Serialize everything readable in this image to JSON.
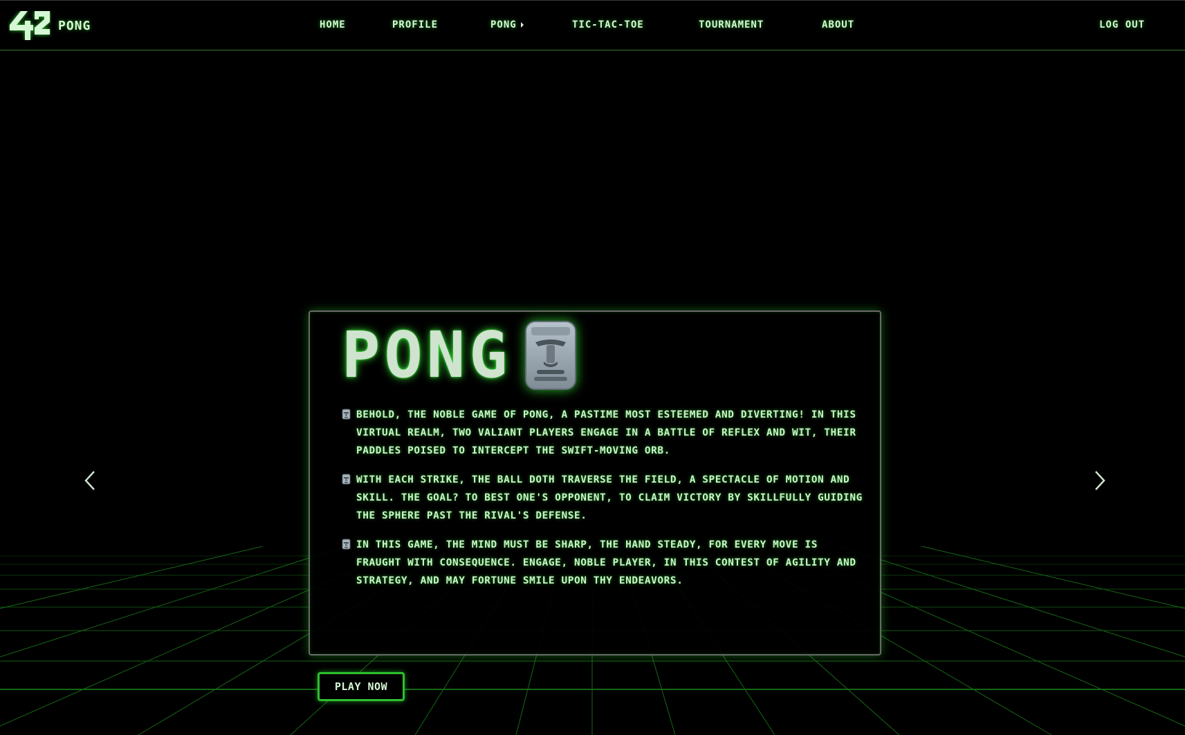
{
  "navbar": {
    "brand_text": "PONG",
    "links": {
      "home": "HOME",
      "profile": "PROFILE",
      "pong": "PONG",
      "tictactoe": "TIC-TAC-TOE",
      "tournament": "TOURNAMENT",
      "about": "ABOUT",
      "logout": "LOG OUT"
    }
  },
  "card": {
    "title": "PONG",
    "paragraphs": [
      "BEHOLD, THE NOBLE GAME OF PONG, A PASTIME MOST ESTEEMED AND DIVERTING! IN THIS VIRTUAL REALM, TWO VALIANT PLAYERS ENGAGE IN A BATTLE OF REFLEX AND WIT, THEIR PADDLES POISED TO INTERCEPT THE SWIFT-MOVING ORB.",
      "WITH EACH STRIKE, THE BALL DOTH TRAVERSE THE FIELD, A SPECTACLE OF MOTION AND SKILL. THE GOAL? TO BEST ONE'S OPPONENT, TO CLAIM VICTORY BY SKILLFULLY GUIDING THE SPHERE PAST THE RIVAL'S DEFENSE.",
      "IN THIS GAME, THE MIND MUST BE SHARP, THE HAND STEADY, FOR EVERY MOVE IS FRAUGHT WITH CONSEQUENCE. ENGAGE, NOBLE PLAYER, IN THIS CONTEST OF AGILITY AND STRATEGY, AND MAY FORTUNE SMILE UPON THY ENDEAVORS."
    ]
  },
  "play_button": "PLAY NOW",
  "icons": {
    "logo": "42-logo",
    "title_icon": "moai-icon",
    "paragraph_icon": "moai-icon",
    "prev": "chevron-left-icon",
    "next": "chevron-right-icon"
  },
  "colors": {
    "background": "#000000",
    "accent": "#2fbf2f",
    "text": "#c8f5c8",
    "grid": "#1f8a1f"
  }
}
